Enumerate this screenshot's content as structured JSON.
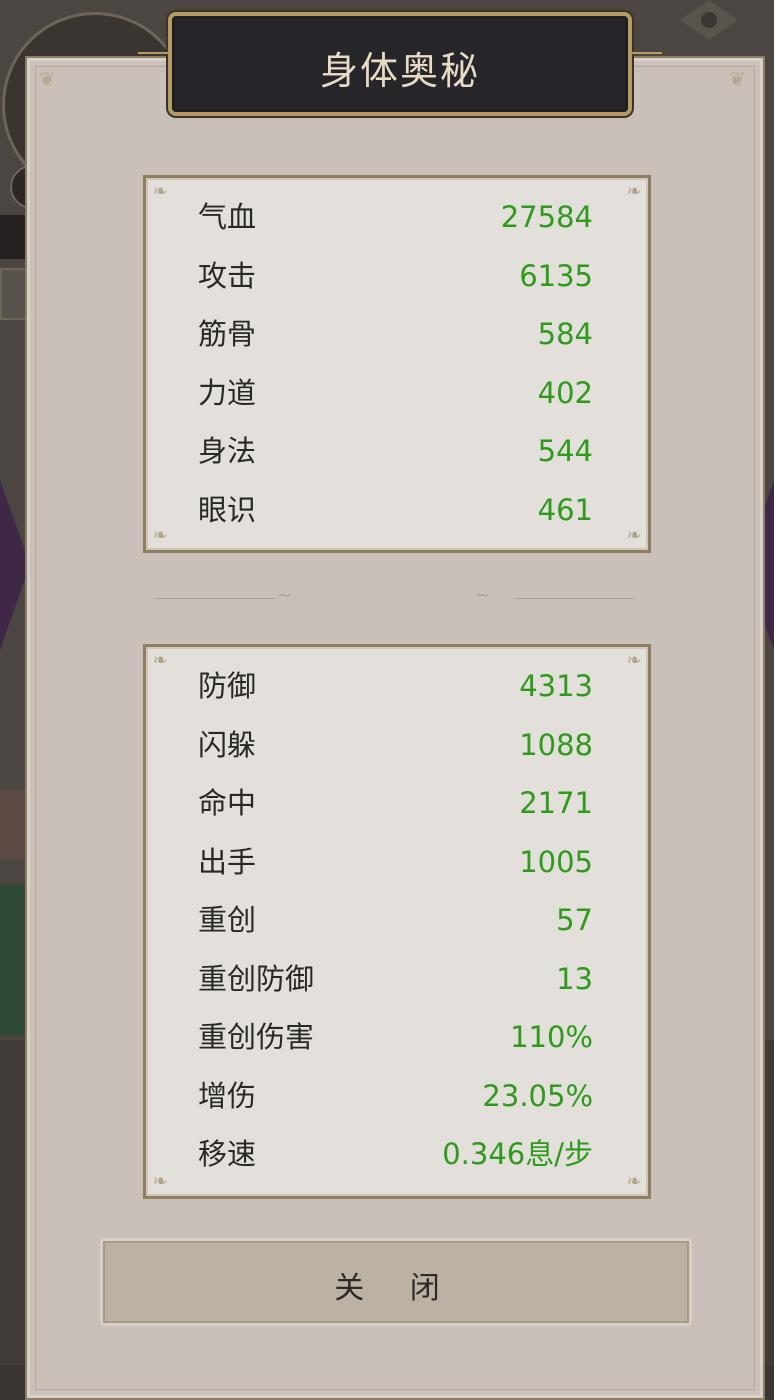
{
  "dialog": {
    "title": "身体奥秘",
    "close_label": "关 闭"
  },
  "basic_stats": [
    {
      "label": "气血",
      "value": "27584"
    },
    {
      "label": "攻击",
      "value": "6135"
    },
    {
      "label": "筋骨",
      "value": "584"
    },
    {
      "label": "力道",
      "value": "402"
    },
    {
      "label": "身法",
      "value": "544"
    },
    {
      "label": "眼识",
      "value": "461"
    }
  ],
  "combat_stats": [
    {
      "label": "防御",
      "value": "4313"
    },
    {
      "label": "闪躲",
      "value": "1088"
    },
    {
      "label": "命中",
      "value": "2171"
    },
    {
      "label": "出手",
      "value": "1005"
    },
    {
      "label": "重创",
      "value": "57"
    },
    {
      "label": "重创防御",
      "value": "13"
    },
    {
      "label": "重创伤害",
      "value": "110%"
    },
    {
      "label": "增伤",
      "value": "23.05%"
    },
    {
      "label": "移速",
      "value": "0.346息/步"
    }
  ],
  "colors": {
    "value_green": "#2f9a1c",
    "label_dark": "#2a2826",
    "title_gold": "#e7dbc4",
    "frame_gold": "#b69a63"
  },
  "icons": {
    "background_eye": "eye-icon"
  }
}
